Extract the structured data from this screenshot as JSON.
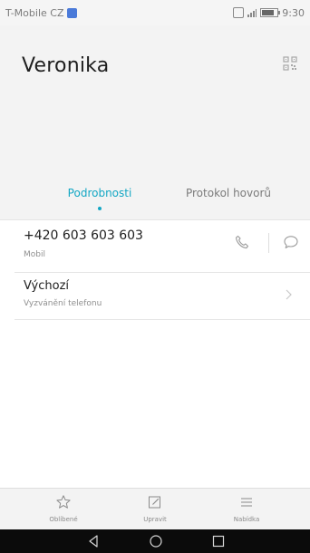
{
  "status_bar": {
    "carrier": "T-Mobile CZ",
    "time": "9:30",
    "battery_level": 0.8
  },
  "contact": {
    "name": "Veronika"
  },
  "tabs": {
    "details": "Podrobnosti",
    "call_log": "Protokol hovorů",
    "active": "details"
  },
  "phone": {
    "number": "+420 603 603 603",
    "type": "Mobil"
  },
  "ringtone": {
    "title": "Výchozí",
    "subtitle": "Vyzvánění telefonu"
  },
  "bottom_actions": {
    "favorite": "Oblíbené",
    "edit": "Upravit",
    "menu": "Nabídka"
  },
  "icons": {
    "qr": "qr-code-icon",
    "call": "phone-icon",
    "message": "message-icon",
    "chevron": "chevron-right-icon",
    "favorite": "star-icon",
    "edit": "edit-icon",
    "menu": "menu-icon",
    "nav_back": "back-triangle-icon",
    "nav_home": "home-circle-icon",
    "nav_recents": "recents-square-icon"
  },
  "colors": {
    "accent": "#13a7c4",
    "text_primary": "#1e1e1e",
    "text_secondary": "#8f8f8f"
  }
}
